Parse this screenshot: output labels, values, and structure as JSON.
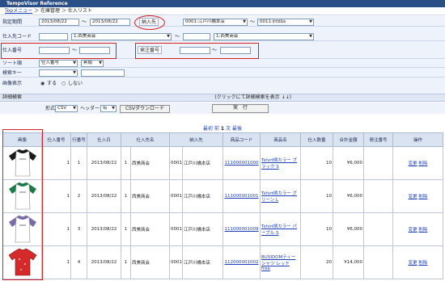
{
  "app": {
    "title": "TempoVisor Reference"
  },
  "breadcrumb": {
    "home": "Topメニュー",
    "sep1": " ＞ ",
    "section": "在庫管理",
    "sep2": " ＞ ",
    "page": "仕入リスト"
  },
  "form": {
    "date_label": "指定期間",
    "date_from": "2013/08/22",
    "tilde": "～",
    "date_to": "2013/08/22",
    "dest_label": "納入先",
    "dest_from": "0001:江戸川橋本店",
    "dest_to": "0011:府田店",
    "supplier_label": "仕入先コード",
    "supplier_from": "1:西美商会",
    "supplier_to": "1:西美商会",
    "purchase_no_label": "仕入番号",
    "purchase_no_from": "",
    "purchase_no_to": "",
    "order_no_label": "発注番号",
    "order_no_from": "",
    "order_no_to": "",
    "sort_label": "ソート順",
    "sort_field": "仕入番号",
    "sort_order": "昇順",
    "keyword_label": "検索キー",
    "keyword_field": "",
    "keyword_value": "",
    "image_label": "画像表示",
    "image_on": "する",
    "image_off": "しない"
  },
  "detail_bar": {
    "left": "詳細検索",
    "right": "(クリックにて詳細検索を表示 ↓↓)"
  },
  "actions": {
    "format_label": "形式",
    "format_value": "CSV",
    "header_label": "ヘッダー",
    "header_value": "有",
    "csv_download": "CSVダウンロード",
    "execute": "実　行"
  },
  "pager": {
    "first": "最初",
    "prev": "前",
    "page": "1",
    "next": "次",
    "last": "最後"
  },
  "table": {
    "columns": [
      "画像",
      "仕入番号",
      "行番号",
      "仕入日",
      "仕入先名",
      "納入先",
      "商品コード",
      "商品名",
      "仕入数量",
      "合計金額",
      "発注番号",
      "操作"
    ],
    "rows": [
      {
        "shirt_color": "#1a1a1a",
        "shirt_style": "raglan",
        "purchase_no": "1",
        "line_no": "1",
        "date": "2013/08/22",
        "supplier_code": "1",
        "supplier_name": "西美商会",
        "dest_code": "0001",
        "dest_name": "江戸川橋本店",
        "product_code": "111000001000",
        "product_name": "Tshirt柄カラー ブラック S",
        "qty": "10",
        "total": "¥6,000",
        "order_no": "",
        "edit": "変更",
        "delete": "削除"
      },
      {
        "shirt_color": "#1c7a4a",
        "shirt_style": "raglan",
        "purchase_no": "1",
        "line_no": "2",
        "date": "2013/08/22",
        "supplier_code": "1",
        "supplier_name": "西美商会",
        "dest_code": "0001",
        "dest_name": "江戸川橋本店",
        "product_code": "111000001001",
        "product_name": "Tshirt柄カラー グリーン L",
        "qty": "10",
        "total": "¥6,000",
        "order_no": "",
        "edit": "変更",
        "delete": "削除"
      },
      {
        "shirt_color": "#7a6aa8",
        "shirt_style": "raglan",
        "purchase_no": "1",
        "line_no": "3",
        "date": "2013/08/22",
        "supplier_code": "1",
        "supplier_name": "西美商会",
        "dest_code": "0001",
        "dest_name": "江戸川橋本店",
        "product_code": "111000001009",
        "product_name": "Tshirt柄カラー パープル S",
        "qty": "10",
        "total": "¥6,000",
        "order_no": "",
        "edit": "変更",
        "delete": "削除"
      },
      {
        "shirt_color": "#d42a2a",
        "shirt_style": "full",
        "purchase_no": "1",
        "line_no": "4",
        "date": "2013/08/22",
        "supplier_code": "1",
        "supplier_name": "西美商会",
        "dest_code": "0001",
        "dest_name": "江戸川橋本店",
        "product_code": "112000001002",
        "product_name": "BUSIDOMティーシャツ レッド free",
        "qty": "20",
        "total": "¥14,000",
        "order_no": "",
        "edit": "変更",
        "delete": "削除"
      }
    ]
  },
  "colors": {
    "highlight": "#d42020",
    "header_bg": "#2a4f86",
    "link": "#1a3fb8"
  }
}
